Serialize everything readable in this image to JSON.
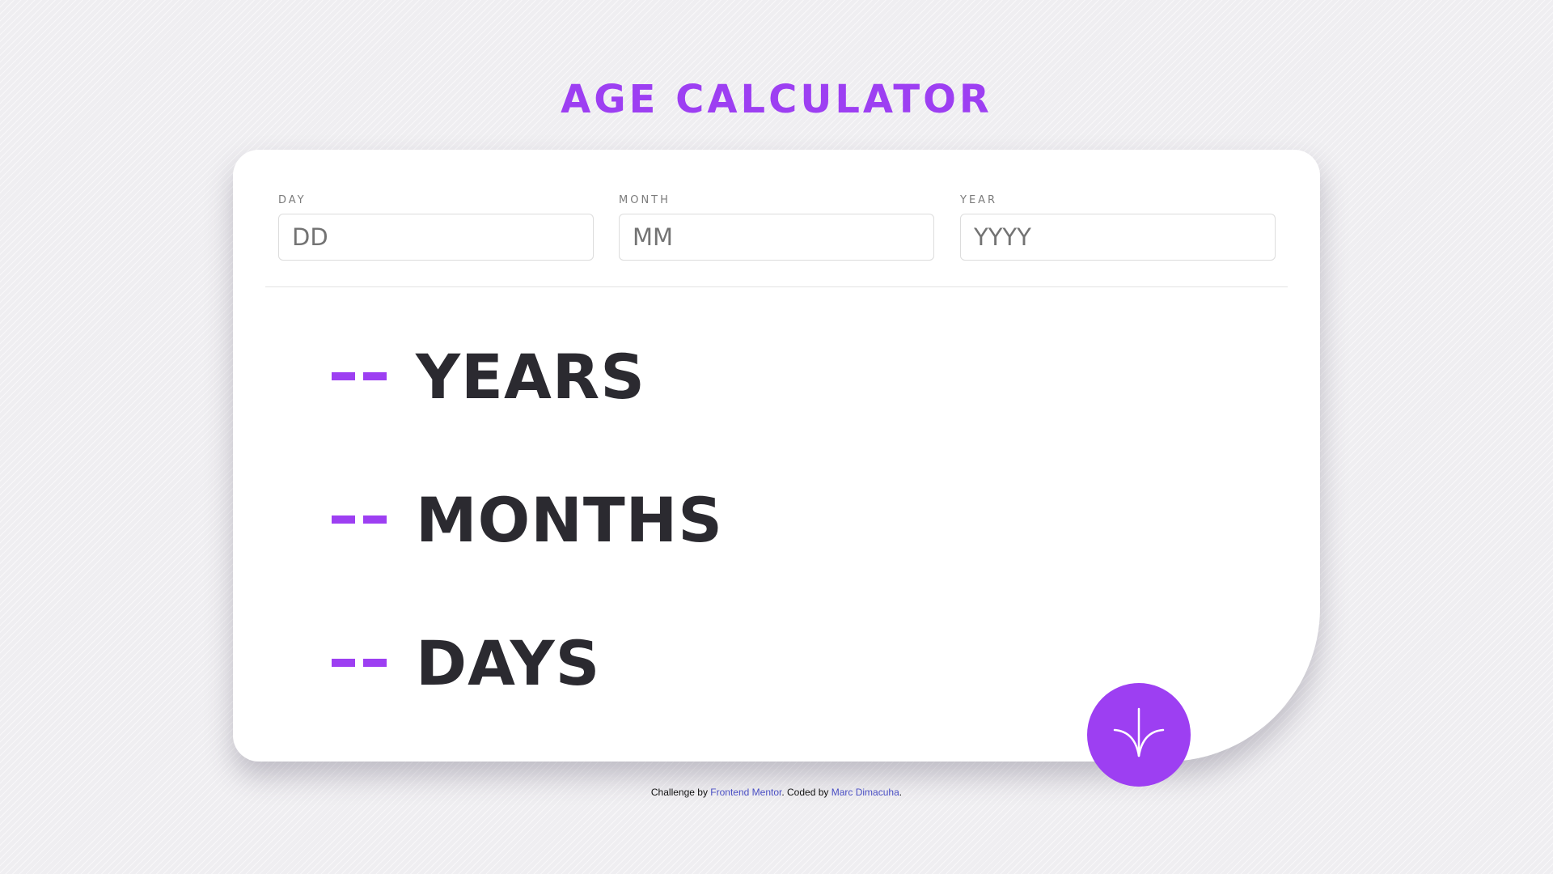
{
  "colors": {
    "accent": "#9d3ff2",
    "result_text": "#2b2a30",
    "link": "#4a4fc4"
  },
  "header": {
    "title": "AGE CALCULATOR"
  },
  "form": {
    "day": {
      "label": "DAY",
      "placeholder": "DD",
      "value": ""
    },
    "month": {
      "label": "MONTH",
      "placeholder": "MM",
      "value": ""
    },
    "year": {
      "label": "YEAR",
      "placeholder": "YYYY",
      "value": ""
    }
  },
  "results": {
    "years": {
      "value": "- -",
      "label": "YEARS"
    },
    "months": {
      "value": "- -",
      "label": "MONTHS"
    },
    "days": {
      "value": "- -",
      "label": "DAYS"
    }
  },
  "submit": {
    "icon": "arrow-down-icon"
  },
  "footer": {
    "prefix": "Challenge by ",
    "challenge_link": "Frontend Mentor",
    "middle": ". Coded by ",
    "author_link": "Marc Dimacuha",
    "suffix": "."
  }
}
